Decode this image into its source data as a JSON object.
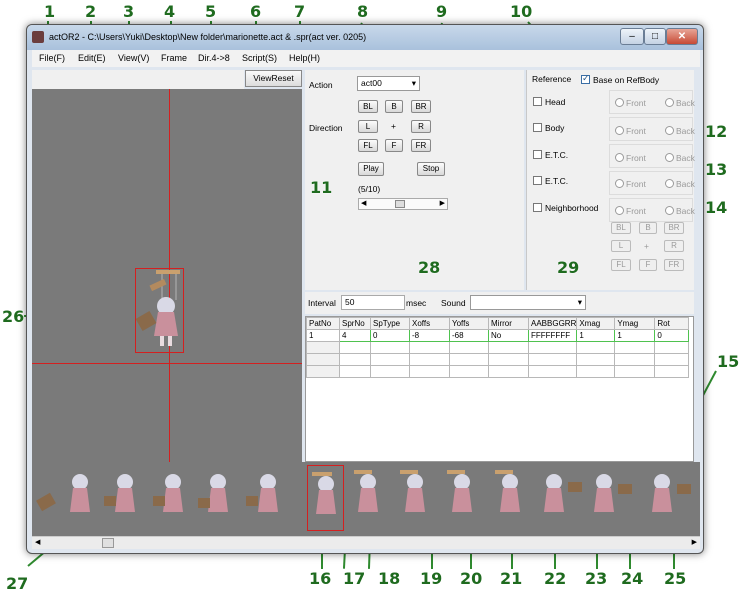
{
  "window": {
    "title": "actOR2 - C:\\Users\\Yuki\\Desktop\\New folder\\marionette.act & .spr(act ver. 0205)"
  },
  "menu": [
    "File(F)",
    "Edit(E)",
    "View(V)",
    "Frame",
    "Dir.4->8",
    "Script(S)",
    "Help(H)"
  ],
  "toolbar": {
    "viewreset": "ViewReset"
  },
  "action": {
    "label": "Action",
    "value": "act00"
  },
  "direction": {
    "label": "Direction",
    "buttons": [
      "BL",
      "B",
      "BR",
      "L",
      "+",
      "R",
      "FL",
      "F",
      "FR"
    ]
  },
  "playback": {
    "play": "Play",
    "stop": "Stop",
    "frame_counter": "(5/10)",
    "slider_level": 0.45
  },
  "reference": {
    "label": "Reference",
    "base_on_refbody": "Base on RefBody",
    "base_checked": true,
    "items": [
      "Head",
      "Body",
      "E.T.C.",
      "E.T.C.",
      "Neighborhood"
    ],
    "front": "Front",
    "back": "Back",
    "dir_buttons": [
      "BL",
      "B",
      "BR",
      "L",
      "+",
      "R",
      "FL",
      "F",
      "FR"
    ]
  },
  "interval": {
    "label": "Interval",
    "value": "50",
    "unit": "msec",
    "sound_label": "Sound",
    "sound_value": ""
  },
  "table": {
    "headers": [
      "PatNo",
      "SprNo",
      "SpType",
      "Xoffs",
      "Yoffs",
      "Mirror",
      "AABBGGRR",
      "Xmag",
      "Ymag",
      "Rot"
    ],
    "rows": [
      [
        "1",
        "4",
        "0",
        "-8",
        "-68",
        "No",
        "FFFFFFFF",
        "1",
        "1",
        "0"
      ]
    ]
  },
  "callouts": [
    "1",
    "2",
    "3",
    "4",
    "5",
    "6",
    "7",
    "8",
    "9",
    "10",
    "11",
    "12",
    "13",
    "14",
    "15",
    "16",
    "17",
    "18",
    "19",
    "20",
    "21",
    "22",
    "23",
    "24",
    "25",
    "26",
    "27",
    "28",
    "29"
  ],
  "colors": {
    "callout": "#1f6b1f",
    "guide": "#d42020",
    "viewport": "#7a7a7a"
  }
}
